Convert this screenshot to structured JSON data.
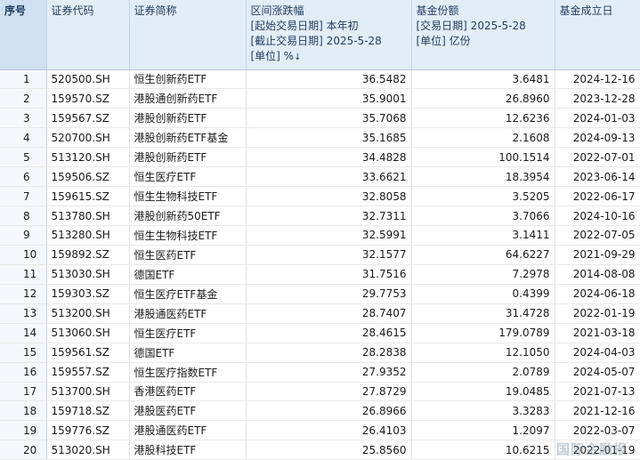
{
  "header": {
    "index": "序号",
    "code": "证券代码",
    "name": "证券简称",
    "change_lines": [
      "区间涨跌幅",
      "[起始交易日期] 本年初",
      "[截止交易日期] 2025-5-28",
      "[单位] %"
    ],
    "change_sort_icon": "sort-down-arrow",
    "shares_lines": [
      "基金份额",
      "[交易日期] 2025-5-28",
      "[单位] 亿份"
    ],
    "date": "基金成立日"
  },
  "rows": [
    {
      "idx": "1",
      "code": "520500.SH",
      "name": "恒生创新药ETF",
      "change": "36.5482",
      "shares": "3.6481",
      "date": "2024-12-16"
    },
    {
      "idx": "2",
      "code": "159570.SZ",
      "name": "港股通创新药ETF",
      "change": "35.9001",
      "shares": "26.8960",
      "date": "2023-12-28"
    },
    {
      "idx": "3",
      "code": "159567.SZ",
      "name": "港股创新药ETF",
      "change": "35.7068",
      "shares": "12.6236",
      "date": "2024-01-03"
    },
    {
      "idx": "4",
      "code": "520700.SH",
      "name": "港股创新药ETF基金",
      "change": "35.1685",
      "shares": "2.1608",
      "date": "2024-09-13"
    },
    {
      "idx": "5",
      "code": "513120.SH",
      "name": "港股创新药ETF",
      "change": "34.4828",
      "shares": "100.1514",
      "date": "2022-07-01"
    },
    {
      "idx": "6",
      "code": "159506.SZ",
      "name": "恒生医疗ETF",
      "change": "33.6621",
      "shares": "18.3954",
      "date": "2023-06-14"
    },
    {
      "idx": "7",
      "code": "159615.SZ",
      "name": "恒生生物科技ETF",
      "change": "32.8058",
      "shares": "3.5205",
      "date": "2022-06-17"
    },
    {
      "idx": "8",
      "code": "513780.SH",
      "name": "港股创新药50ETF",
      "change": "32.7311",
      "shares": "3.7066",
      "date": "2024-10-16"
    },
    {
      "idx": "9",
      "code": "513280.SH",
      "name": "恒生生物科技ETF",
      "change": "32.5991",
      "shares": "3.1411",
      "date": "2022-07-05"
    },
    {
      "idx": "10",
      "code": "159892.SZ",
      "name": "恒生医药ETF",
      "change": "32.1577",
      "shares": "64.6227",
      "date": "2021-09-29"
    },
    {
      "idx": "11",
      "code": "513030.SH",
      "name": "德国ETF",
      "change": "31.7516",
      "shares": "7.2978",
      "date": "2014-08-08"
    },
    {
      "idx": "12",
      "code": "159303.SZ",
      "name": "恒生医疗ETF基金",
      "change": "29.7753",
      "shares": "0.4399",
      "date": "2024-06-18"
    },
    {
      "idx": "13",
      "code": "513200.SH",
      "name": "港股通医药ETF",
      "change": "28.7407",
      "shares": "31.4728",
      "date": "2022-01-19"
    },
    {
      "idx": "14",
      "code": "513060.SH",
      "name": "恒生医疗ETF",
      "change": "28.4615",
      "shares": "179.0789",
      "date": "2021-03-18"
    },
    {
      "idx": "15",
      "code": "159561.SZ",
      "name": "德国ETF",
      "change": "28.2838",
      "shares": "12.1050",
      "date": "2024-04-03"
    },
    {
      "idx": "16",
      "code": "159557.SZ",
      "name": "恒生医疗指数ETF",
      "change": "27.9352",
      "shares": "2.0789",
      "date": "2024-05-07"
    },
    {
      "idx": "17",
      "code": "513700.SH",
      "name": "香港医药ETF",
      "change": "27.8729",
      "shares": "19.0485",
      "date": "2021-07-13"
    },
    {
      "idx": "18",
      "code": "159718.SZ",
      "name": "港股医药ETF",
      "change": "26.8966",
      "shares": "3.3283",
      "date": "2021-12-16"
    },
    {
      "idx": "19",
      "code": "159776.SZ",
      "name": "港股通医药ETF",
      "change": "26.4103",
      "shares": "1.2097",
      "date": "2022-03-07"
    },
    {
      "idx": "20",
      "code": "513020.SH",
      "name": "港股科技ETF",
      "change": "25.8560",
      "shares": "10.6215",
      "date": "2022-01-19"
    }
  ],
  "watermark": "国际金融报"
}
